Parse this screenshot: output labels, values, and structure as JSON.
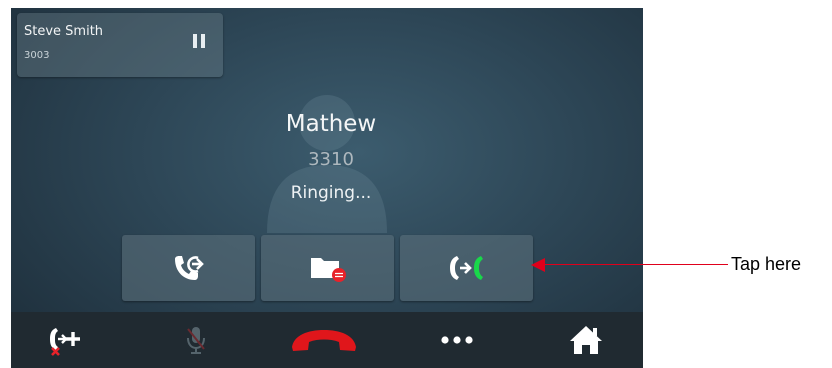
{
  "held_call": {
    "name": "Steve Smith",
    "extension": "3003"
  },
  "active_call": {
    "name": "Mathew",
    "extension": "3310",
    "status": "Ringing..."
  },
  "action_buttons": [
    {
      "icon": "call-forward-icon"
    },
    {
      "icon": "voicemail-folder-icon"
    },
    {
      "icon": "transfer-call-icon"
    }
  ],
  "toolbar": {
    "items": [
      {
        "icon": "add-participant-icon"
      },
      {
        "icon": "mute-microphone-icon",
        "disabled": true
      },
      {
        "icon": "end-call-icon"
      },
      {
        "icon": "more-options-icon"
      },
      {
        "icon": "home-icon"
      }
    ]
  },
  "colors": {
    "end_call_red": "#e0161b",
    "transfer_green": "#19d84a",
    "badge_red": "#e8222a",
    "callout_red": "#e0001b"
  },
  "annotation": {
    "text": "Tap here"
  }
}
